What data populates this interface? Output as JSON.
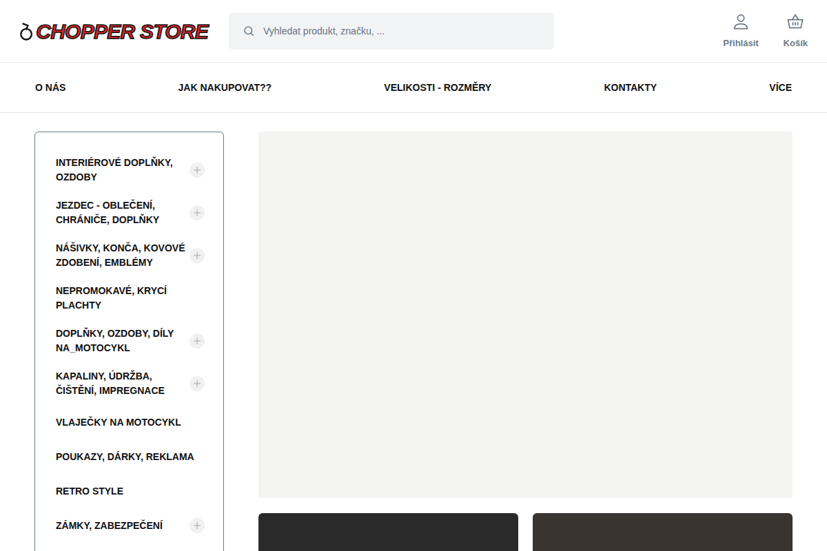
{
  "header": {
    "logo": "CHOPPER STORE",
    "search": {
      "placeholder": "Vyhledat produkt, značku, ..."
    },
    "actions": [
      {
        "label": "Přihlásit",
        "kind": "user"
      },
      {
        "label": "Košík",
        "kind": "cart"
      }
    ]
  },
  "nav": [
    {
      "label": "O NÁS"
    },
    {
      "label": "JAK NAKUPOVAT??"
    },
    {
      "label": "VELIKOSTI - ROZMĚRY"
    },
    {
      "label": "KONTAKTY"
    },
    {
      "label": "VÍCE"
    }
  ],
  "sidebar": {
    "items": [
      {
        "label": "INTERIÉROVÉ DOPLŇKY, OZDOBY",
        "expandable": true,
        "expanded": false
      },
      {
        "label": "JEZDEC - OBLEČENÍ, CHRÁNIČE, DOPLŇKY",
        "expandable": true,
        "expanded": false
      },
      {
        "label": "NÁŠIVKY, KONČA, KOVOVÉ ZDOBENÍ, EMBLÉMY",
        "expandable": true,
        "expanded": false
      },
      {
        "label": "NEPROMOKAVÉ, KRYCÍ PLACHTY",
        "expandable": false,
        "expanded": false
      },
      {
        "label": "DOPLŇKY, OZDOBY, DÍLY NA_MOTOCYKL",
        "expandable": true,
        "expanded": false
      },
      {
        "label": "KAPALINY, ÚDRŽBA, ČIŠTĚNÍ, IMPREGNACE",
        "expandable": true,
        "expanded": false
      },
      {
        "label": "VLAJEČKY NA MOTOCYKL",
        "expandable": false,
        "expanded": false
      },
      {
        "label": "POUKAZY, DÁRKY, REKLAMA",
        "expandable": false,
        "expanded": false
      },
      {
        "label": "RETRO STYLE",
        "expandable": false,
        "expanded": false
      },
      {
        "label": "ZÁMKY, ZABEZPEČENÍ",
        "expandable": true,
        "expanded": false
      }
    ]
  },
  "banners": [
    {
      "kind": "main",
      "color": "#f4f4f2"
    },
    {
      "kind": "small",
      "color": "#2a2a2a"
    },
    {
      "kind": "small",
      "color": "#3a3431"
    }
  ]
}
